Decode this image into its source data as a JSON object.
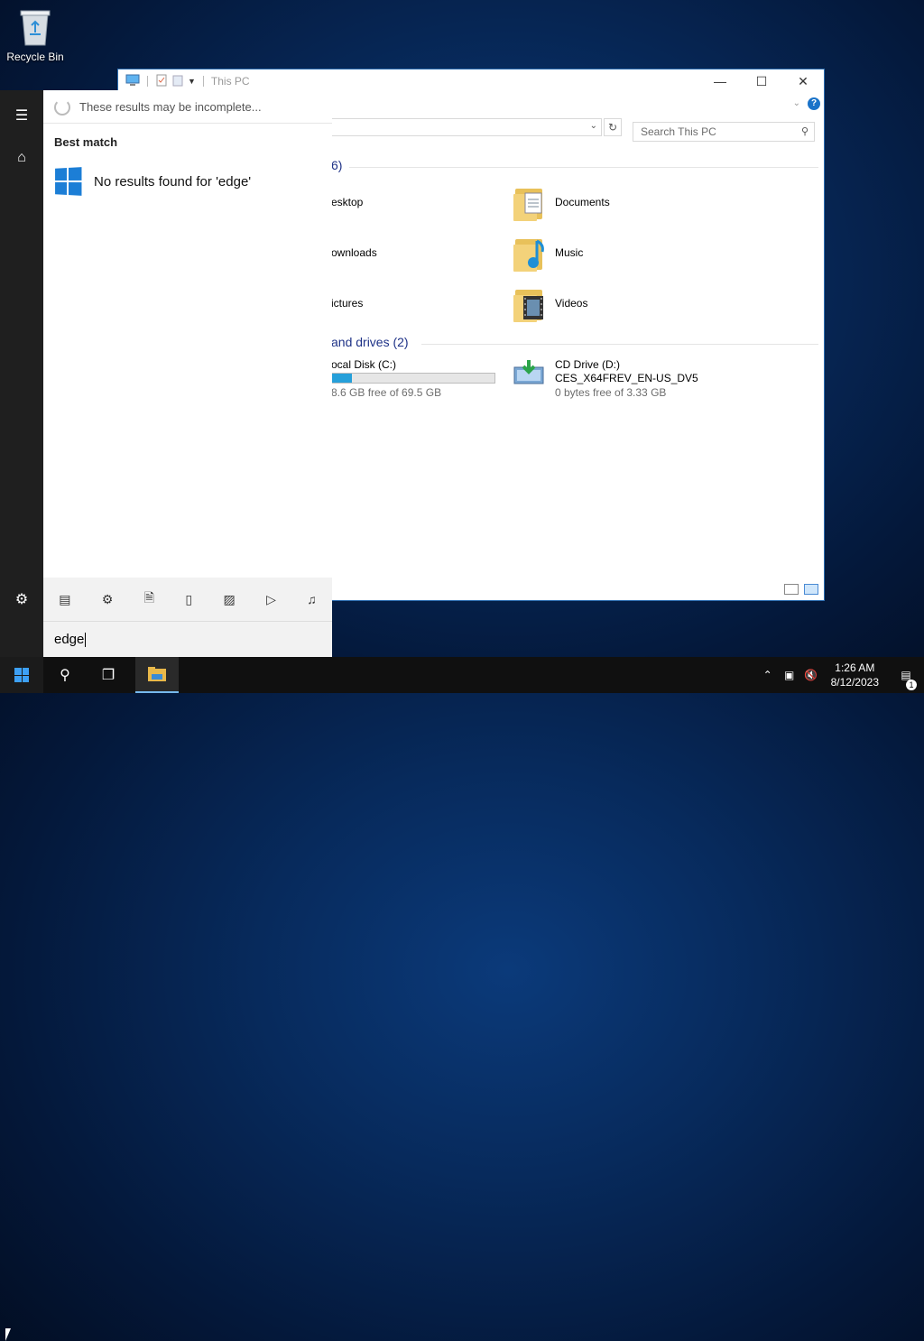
{
  "desktop": {
    "recycle_bin_label": "Recycle Bin"
  },
  "explorer": {
    "title": "This PC",
    "search_placeholder": "Search This PC",
    "folders_group": "6)",
    "drives_group": "and drives (2)",
    "folders": [
      {
        "name": "esktop"
      },
      {
        "name": "Documents"
      },
      {
        "name": "ownloads"
      },
      {
        "name": "Music"
      },
      {
        "name": "ictures"
      },
      {
        "name": "Videos"
      }
    ],
    "drives": [
      {
        "name": "ocal Disk (C:)",
        "free_text": "8.6 GB free of 69.5 GB",
        "used_fraction": 0.12
      },
      {
        "name": "CD Drive (D:)",
        "label": "CES_X64FREV_EN-US_DV5",
        "free_text": "0 bytes free of 3.33 GB"
      }
    ]
  },
  "search_pane": {
    "status": "These results may be incomplete...",
    "best_match_label": "Best match",
    "no_results": "No results found for 'edge'",
    "query": "edge",
    "filter_icons": [
      "apps-icon",
      "settings-icon",
      "documents-icon",
      "tablet-icon",
      "photos-icon",
      "videos-icon",
      "music-icon"
    ]
  },
  "taskbar": {
    "time": "1:26 AM",
    "date": "8/12/2023",
    "notification_count": "1"
  }
}
